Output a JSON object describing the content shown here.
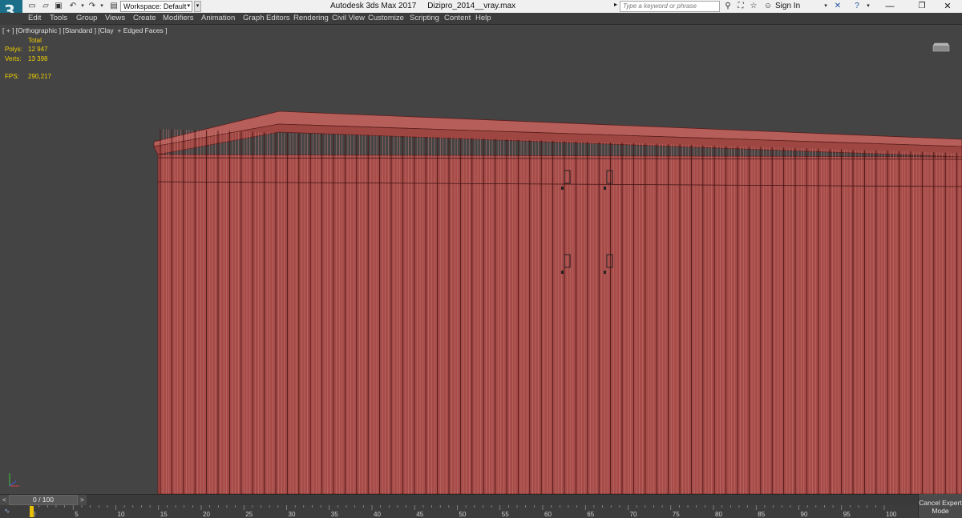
{
  "titlebar": {
    "logo_text": "3",
    "workspace_label": "Workspace: Default",
    "app_name": "Autodesk 3ds Max 2017",
    "file_name": "Dizipro_2014__vray.max",
    "search_placeholder": "Type a keyword or phrase",
    "sign_in": "Sign In"
  },
  "menu": {
    "items": [
      "Edit",
      "Tools",
      "Group",
      "Views",
      "Create",
      "Modifiers",
      "Animation",
      "Graph Editors",
      "Rendering",
      "Civil View",
      "Customize",
      "Scripting",
      "Content",
      "Help"
    ]
  },
  "viewport": {
    "label": "[ + ] [Orthographic ] [Standard ] [Clay  + Edged Faces ]",
    "stats": {
      "total_label": "Total",
      "polys_label": "Polys:",
      "polys_value": "12 947",
      "verts_label": "Verts:",
      "verts_value": "13 398",
      "fps_label": "FPS:",
      "fps_value": "290,217"
    },
    "model_color": "#a64b48",
    "wire_color": "#5a1f1c"
  },
  "timeline": {
    "slider_text": "0 / 100",
    "prev_symbol": "<",
    "next_symbol": ">",
    "ticks": [
      "0",
      "5",
      "10",
      "15",
      "20",
      "25",
      "30",
      "35",
      "40",
      "45",
      "50",
      "55",
      "60",
      "65",
      "70",
      "75",
      "80",
      "85",
      "90",
      "95",
      "100"
    ]
  },
  "status": {
    "cancel_expert_line1": "Cancel Expert",
    "cancel_expert_line2": "Mode"
  }
}
